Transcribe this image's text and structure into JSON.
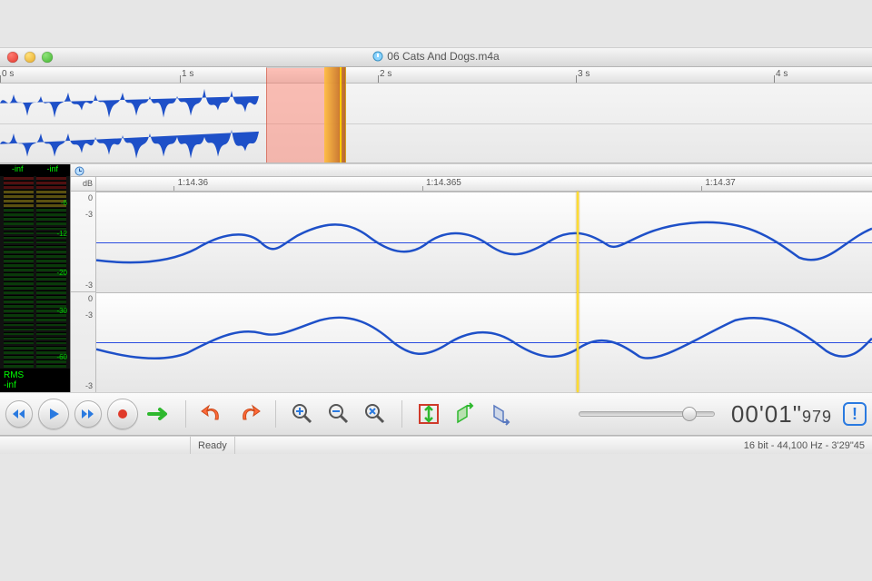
{
  "window": {
    "title": "06 Cats And Dogs.m4a"
  },
  "overview": {
    "ruler_ticks": [
      "0 s",
      "1 s",
      "2 s",
      "3 s",
      "4 s"
    ],
    "selection_start_pct": 30.5,
    "selection_end_pct": 39,
    "play_pos_pct": 37.2,
    "cursor_pct": 39
  },
  "meter": {
    "top_labels": [
      "-inf",
      "-inf"
    ],
    "tick_labels": [
      "-6",
      "-12",
      "-20",
      "-30",
      "-60"
    ],
    "rms_label": "RMS",
    "rms_value": "-inf"
  },
  "detail": {
    "db_unit": "dB",
    "ruler_labels": [
      "1:14.36",
      "1:14.365",
      "1:14.37"
    ],
    "db_ticks": [
      "0",
      "-3"
    ],
    "selection_start_pct": 21,
    "selection_end_pct": 62,
    "cursor_pct": 62
  },
  "transport": {
    "timecode_main": "00'01\"",
    "timecode_ms": "979"
  },
  "status": {
    "ready": "Ready",
    "format": "16 bit - 44,100 Hz - 3'29\"45"
  }
}
